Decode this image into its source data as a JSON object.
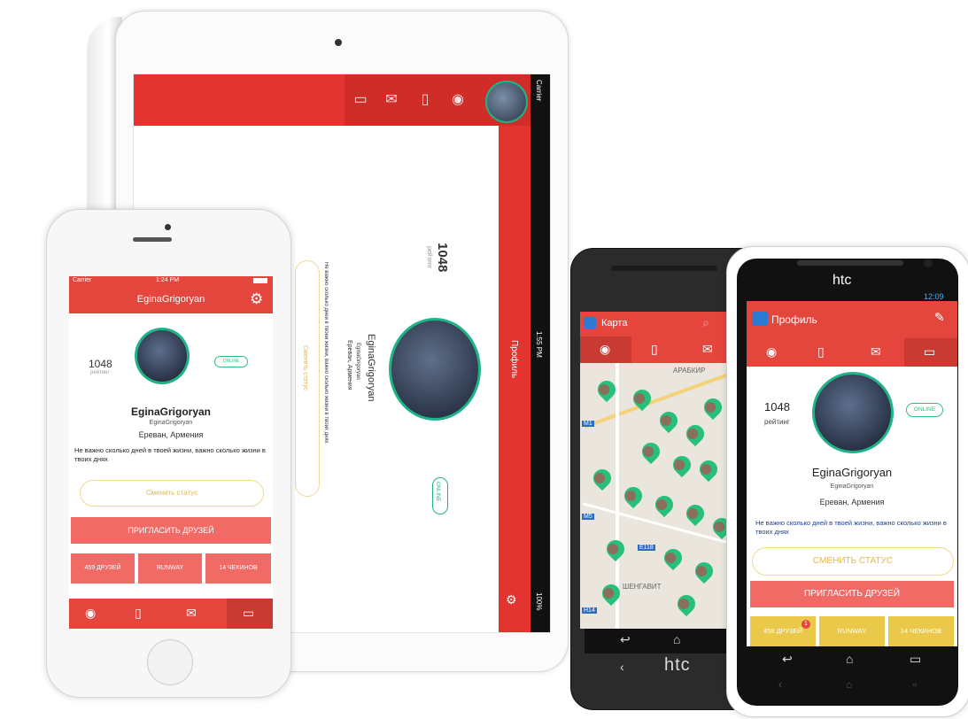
{
  "ipad": {
    "profile_label": "Профиль",
    "rating_value": "1048",
    "rating_label": "рейтинг",
    "username": "EginaGrigoryan",
    "username_small": "EginaGrigoryan",
    "city": "Ереван, Армения",
    "status_text": "Не важно сколько дней в твоей жизни, важно сколько жизни в твоих днях",
    "change_status_label": "Сменить статус",
    "online_label": "ONLINE",
    "carrier": "Carrier",
    "time": "1:55 PM",
    "battery": "100%"
  },
  "iphone": {
    "carrier": "Carrier",
    "time": "1:24 PM",
    "title": "EginaGrigoryan",
    "rating_value": "1048",
    "rating_label": "рейтинг",
    "online_label": "ONLINE",
    "username": "EginaGrigoryan",
    "username_small": "EginaGrigoryan",
    "city": "Ереван, Армения",
    "status_text": "Не важно сколько дней в твоей жизни, важно сколько жизни в твоих днях",
    "change_status_label": "Сменить статус",
    "invite_label": "ПРИГЛАСИТЬ ДРУЗЕЙ",
    "stats": [
      "459 ДРУЗЕЙ",
      "RUNWAY",
      "14 ЧЕКИНОВ"
    ],
    "tab_icons": [
      "pin-icon",
      "book-icon",
      "mail-icon",
      "id-card-icon"
    ]
  },
  "htc_dark": {
    "title": "Карта",
    "brand": "htc",
    "map_labels": [
      "АРАБКИР",
      "ШЕНГАВИТ",
      "M1",
      "M5",
      "E118",
      "H14"
    ],
    "tab_icons": [
      "pin-icon",
      "book-icon",
      "mail-icon"
    ]
  },
  "htc_white": {
    "brand": "htc",
    "time": "12:09",
    "title": "Профиль",
    "rating_value": "1048",
    "rating_label": "рейтинг",
    "online_label": "ONLINE",
    "username": "EginaGrigoryan",
    "username_small": "EginaGrigoryan",
    "city": "Ереван, Армения",
    "status_text": "Не важно сколько дней в твоей жизни, важно сколько жизни в твоих днях",
    "change_status_label": "СМЕНИТЬ СТАТУС",
    "invite_label": "ПРИГЛАСИТЬ ДРУЗЕЙ",
    "stats": [
      "459 ДРУЗЕЙ",
      "RUNWAY",
      "14 ЧЕКИНОВ"
    ],
    "badge_count": "1",
    "tab_icons": [
      "pin-icon",
      "book-icon",
      "mail-icon",
      "id-card-icon"
    ]
  },
  "colors": {
    "primary_red": "#e4463d",
    "salmon": "#f06a66",
    "accent_green": "#1fb488",
    "stat_yellow": "#e9c84a"
  }
}
